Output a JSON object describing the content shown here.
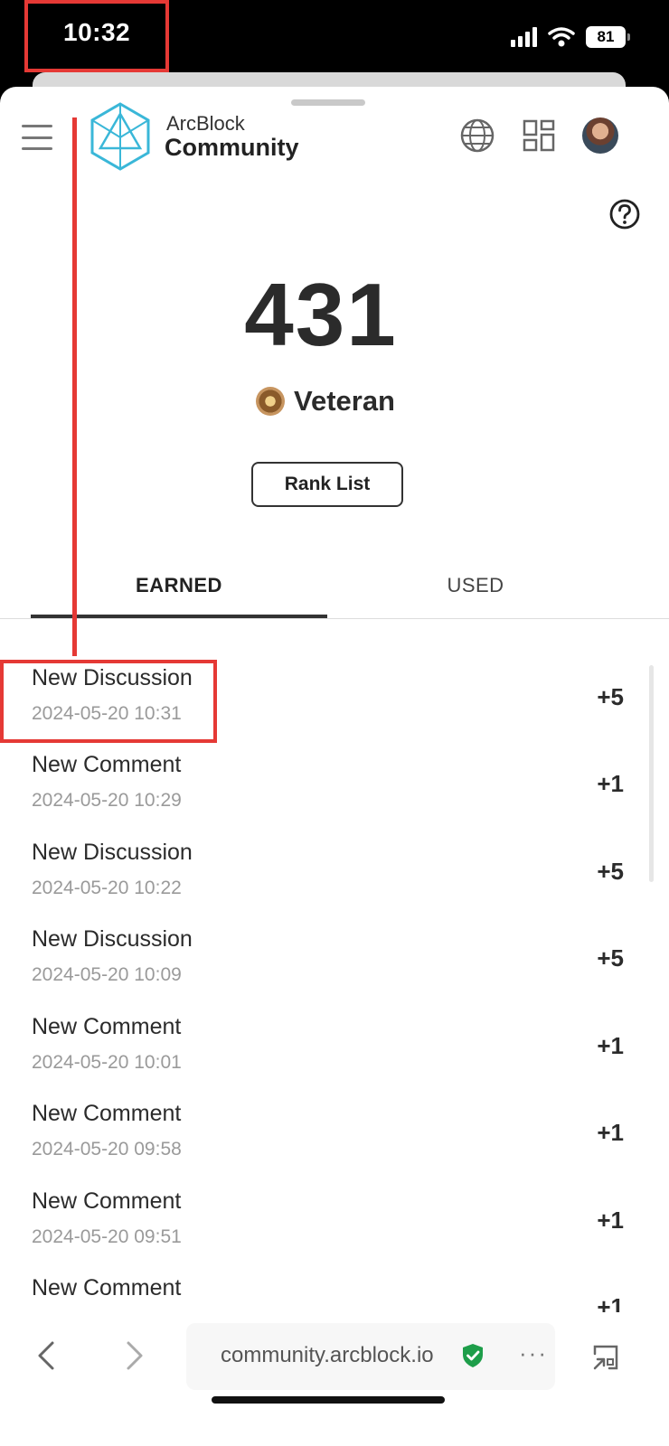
{
  "status_bar": {
    "time": "10:32",
    "battery": "81"
  },
  "header": {
    "brand_top": "ArcBlock",
    "brand_bottom": "Community"
  },
  "points": {
    "value": "431",
    "level": "Veteran",
    "rank_button": "Rank List"
  },
  "tabs": [
    {
      "label": "EARNED",
      "active": true
    },
    {
      "label": "USED",
      "active": false
    }
  ],
  "history": [
    {
      "title": "New Discussion",
      "date": "2024-05-20 10:31",
      "points": "+5"
    },
    {
      "title": "New Comment",
      "date": "2024-05-20 10:29",
      "points": "+1"
    },
    {
      "title": "New Discussion",
      "date": "2024-05-20 10:22",
      "points": "+5"
    },
    {
      "title": "New Discussion",
      "date": "2024-05-20 10:09",
      "points": "+5"
    },
    {
      "title": "New Comment",
      "date": "2024-05-20 10:01",
      "points": "+1"
    },
    {
      "title": "New Comment",
      "date": "2024-05-20 09:58",
      "points": "+1"
    },
    {
      "title": "New Comment",
      "date": "2024-05-20 09:51",
      "points": "+1"
    },
    {
      "title": "New Comment",
      "date": "",
      "points": "+1"
    }
  ],
  "browser": {
    "url": "community.arcblock.io",
    "more": "···"
  },
  "colors": {
    "annotation": "#e53935",
    "secure": "#1e9e4a",
    "logo": "#3ab7d8"
  },
  "icons": [
    "menu-icon",
    "globe-icon",
    "apps-icon",
    "help-icon",
    "medal-icon",
    "back-icon",
    "forward-icon",
    "secure-shield-icon",
    "more-icon",
    "minimize-icon"
  ]
}
